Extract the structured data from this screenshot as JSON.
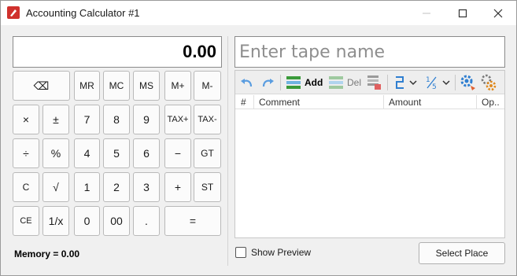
{
  "window": {
    "title": "Accounting Calculator #1"
  },
  "calculator": {
    "display_value": "0.00",
    "memory_label": "Memory = 0.00",
    "keys": {
      "backspace": "⌫",
      "mr": "MR",
      "mc": "MC",
      "ms": "MS",
      "mplus": "M+",
      "mminus": "M-",
      "multiply": "×",
      "plusminus": "±",
      "seven": "7",
      "eight": "8",
      "nine": "9",
      "taxplus": "TAX+",
      "taxminus": "TAX-",
      "divide": "÷",
      "percent": "%",
      "four": "4",
      "five": "5",
      "six": "6",
      "minus": "−",
      "gt": "GT",
      "clear": "C",
      "sqrt": "√",
      "one": "1",
      "two": "2",
      "three": "3",
      "plus": "+",
      "st": "ST",
      "ce": "CE",
      "reciprocal": "1/x",
      "zero": "0",
      "doublezero": "00",
      "decimal": ".",
      "equals": "="
    }
  },
  "tape": {
    "name_placeholder": "Enter tape name",
    "toolbar": {
      "add_label": "Add",
      "del_label": "Del"
    },
    "columns": [
      "#",
      "Comment",
      "Amount",
      "Op.."
    ]
  },
  "footer": {
    "show_preview_label": "Show Preview",
    "select_place_label": "Select Place"
  },
  "colors": {
    "app_icon": "#d0312d",
    "toolbar_blue": "#2f7fd1",
    "toolbar_green": "#3a9a3a",
    "gear_orange": "#e08a1e"
  }
}
